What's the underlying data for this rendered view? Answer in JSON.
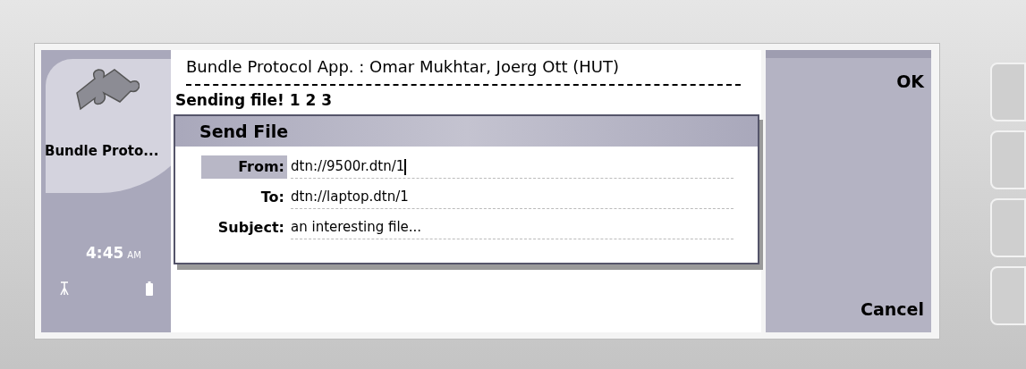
{
  "sidebar": {
    "app_label": "Bundle Proto...",
    "time": "4:45",
    "time_suffix": "AM"
  },
  "main": {
    "title": "Bundle Protocol App. : Omar Mukhtar, Joerg Ott (HUT)",
    "status": "Sending file! 1 2 3"
  },
  "dialog": {
    "title": "Send File",
    "fields": [
      {
        "label": "From:",
        "value": "dtn://9500r.dtn/1",
        "selected": true
      },
      {
        "label": "To:",
        "value": "dtn://laptop.dtn/1",
        "selected": false
      },
      {
        "label": "Subject:",
        "value": "an interesting file...",
        "selected": false
      }
    ]
  },
  "softkeys": [
    {
      "label": "OK"
    },
    {
      "label": "Cancel"
    }
  ]
}
